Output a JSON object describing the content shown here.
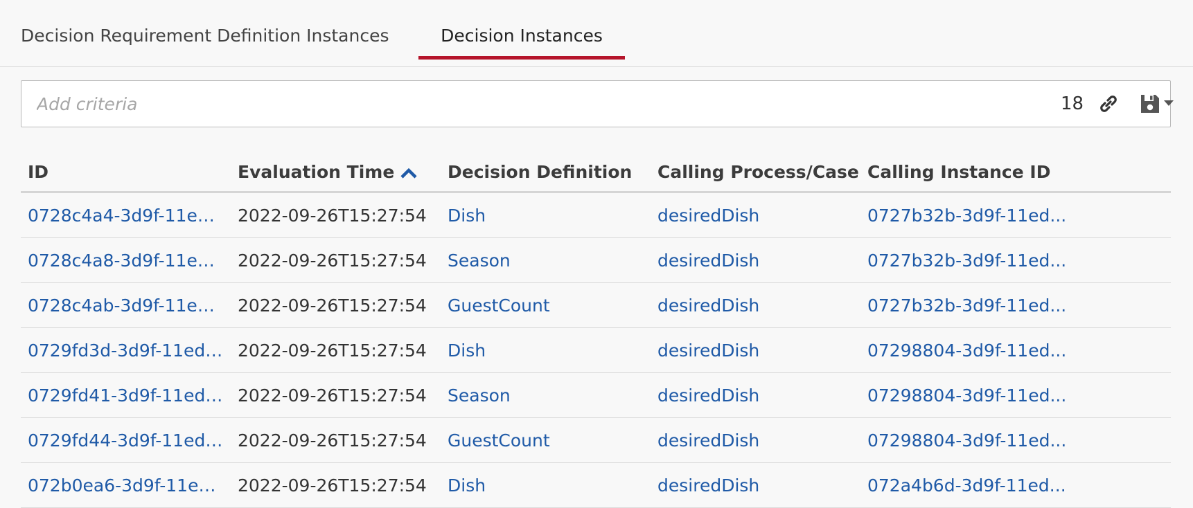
{
  "tabs": [
    {
      "label": "Decision Requirement Definition Instances"
    },
    {
      "label": "Decision Instances"
    }
  ],
  "search": {
    "placeholder": "Add criteria",
    "count": "18",
    "icons": {
      "link": "link-icon",
      "save": "save-icon",
      "caret": "caret-down-icon"
    }
  },
  "table": {
    "columns": [
      "ID",
      "Evaluation Time",
      "Decision Definition",
      "Calling Process/Case",
      "Calling Instance ID"
    ],
    "sort_icon": "chevron-up-icon",
    "rows": [
      [
        "0728c4a4-3d9f-11ed-...",
        "2022-09-26T15:27:54",
        "Dish",
        "desiredDish",
        "0727b32b-3d9f-11ed..."
      ],
      [
        "0728c4a8-3d9f-11ed-...",
        "2022-09-26T15:27:54",
        "Season",
        "desiredDish",
        "0727b32b-3d9f-11ed..."
      ],
      [
        "0728c4ab-3d9f-11ed-...",
        "2022-09-26T15:27:54",
        "GuestCount",
        "desiredDish",
        "0727b32b-3d9f-11ed..."
      ],
      [
        "0729fd3d-3d9f-11ed-...",
        "2022-09-26T15:27:54",
        "Dish",
        "desiredDish",
        "07298804-3d9f-11ed..."
      ],
      [
        "0729fd41-3d9f-11ed-...",
        "2022-09-26T15:27:54",
        "Season",
        "desiredDish",
        "07298804-3d9f-11ed..."
      ],
      [
        "0729fd44-3d9f-11ed-...",
        "2022-09-26T15:27:54",
        "GuestCount",
        "desiredDish",
        "07298804-3d9f-11ed..."
      ],
      [
        "072b0ea6-3d9f-11ed-...",
        "2022-09-26T15:27:54",
        "Dish",
        "desiredDish",
        "072a4b6d-3d9f-11ed..."
      ]
    ]
  },
  "colors": {
    "link": "#1f5aa7",
    "active_tab": "#b5152b",
    "sort_icon": "#1f5aa7"
  }
}
